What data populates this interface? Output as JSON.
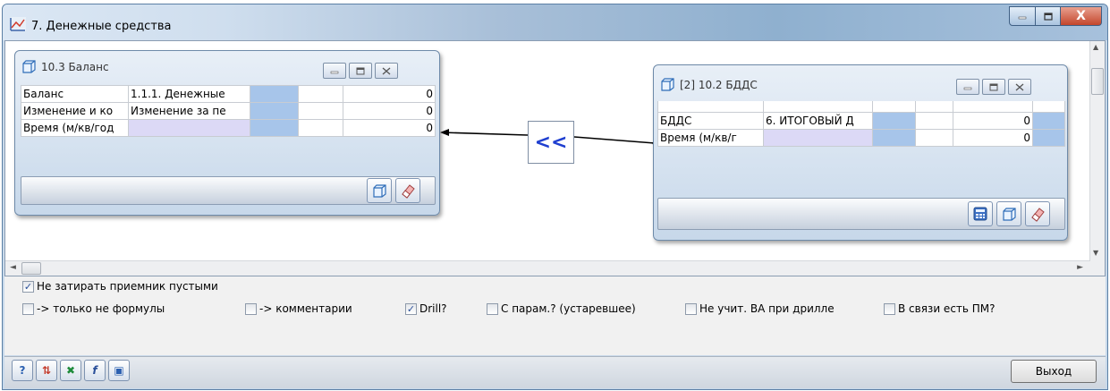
{
  "window": {
    "title": "7. Денежные средства",
    "close_glyph": "X"
  },
  "left_panel": {
    "title": "10.3 Баланс",
    "rows": [
      {
        "c1": "Баланс",
        "c2": "1.1.1. Денежные",
        "value": "0"
      },
      {
        "c1": "Изменение и ко",
        "c2": "Изменение за пе",
        "value": "0"
      },
      {
        "c1": "Время (м/кв/год",
        "c2": "",
        "value": "0"
      }
    ]
  },
  "right_panel": {
    "title": "[2] 10.2 БДДС",
    "rows": [
      {
        "c1": "БДДС",
        "c2": "6. ИТОГОВЫЙ Д",
        "value": "0"
      },
      {
        "c1": "Время (м/кв/г",
        "c2": "",
        "value": "0"
      }
    ]
  },
  "link": {
    "label": "<<"
  },
  "options": {
    "row1": [
      {
        "label": "Не затирать приемник пустыми",
        "checked": true
      }
    ],
    "row2": [
      {
        "label": "-> только не формулы",
        "checked": false
      },
      {
        "label": "-> комментарии",
        "checked": false
      },
      {
        "label": "Drill?",
        "checked": true
      },
      {
        "label": "С парам.? (устаревшее)",
        "checked": false
      },
      {
        "label": "Не учит. ВА при дрилле",
        "checked": false
      },
      {
        "label": "В связи есть ПМ?",
        "checked": false
      }
    ]
  },
  "statusbar": {
    "icons": [
      "help-icon",
      "sort-icon",
      "excel-icon",
      "formula-icon",
      "save-icon"
    ],
    "icon_glyphs": [
      "?",
      "⇅",
      "✖",
      "f",
      "▣"
    ],
    "exit_label": "Выход"
  },
  "colors": {
    "cell_blue": "#a7c5ea",
    "cell_lavender": "#dcd9f6",
    "link_arrow": "#1f3fd0"
  }
}
